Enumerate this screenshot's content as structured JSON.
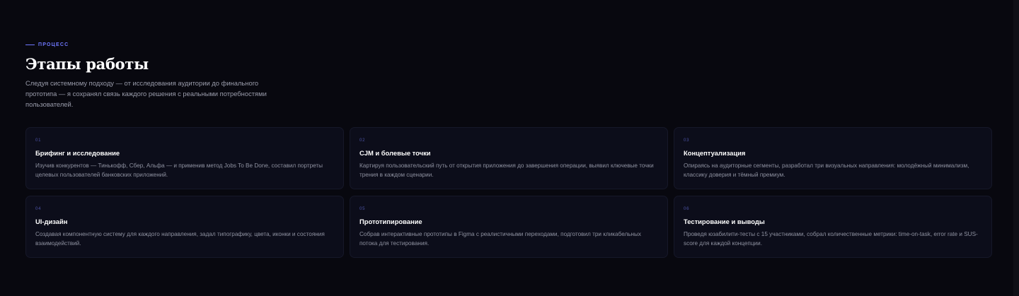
{
  "section": {
    "eyebrow": "ПРОЦЕСС",
    "title": "Этапы работы",
    "subtitle": "Следуя системному подходу — от исследования аудитории до финального прототипа — я сохранял связь каждого решения с реальными потребностями пользователей."
  },
  "steps": [
    {
      "num": "01",
      "title": "Брифинг и исследование",
      "desc": "Изучив конкурентов — Тинькофф, Сбер, Альфа — и применив метод Jobs To Be Done, составил портреты целевых пользователей банковских приложений."
    },
    {
      "num": "02",
      "title": "CJM и болевые точки",
      "desc": "Картируя пользовательский путь от открытия приложения до завершения операции, выявил ключевые точки трения в каждом сценарии."
    },
    {
      "num": "03",
      "title": "Концептуализация",
      "desc": "Опираясь на аудиторные сегменты, разработал три визуальных направления: молодёжный минимализм, классику доверия и тёмный премиум."
    },
    {
      "num": "04",
      "title": "UI-дизайн",
      "desc": "Создавая компонентную систему для каждого направления, задал типографику, цвета, иконки и состояния взаимодействий."
    },
    {
      "num": "05",
      "title": "Прототипирование",
      "desc": "Собрав интерактивные прототипы в Figma с реалистичными переходами, подготовил три кликабельных потока для тестирования."
    },
    {
      "num": "06",
      "title": "Тестирование и выводы",
      "desc": "Проведя юзабилити-тесты с 15 участниками, собрал количественные метрики: time-on-task, error rate и SUS-score для каждой концепции."
    }
  ],
  "colors": {
    "background": "#08080f",
    "accent": "#6f78ff",
    "card_background": "#0c0d1a",
    "card_border": "#161829"
  }
}
